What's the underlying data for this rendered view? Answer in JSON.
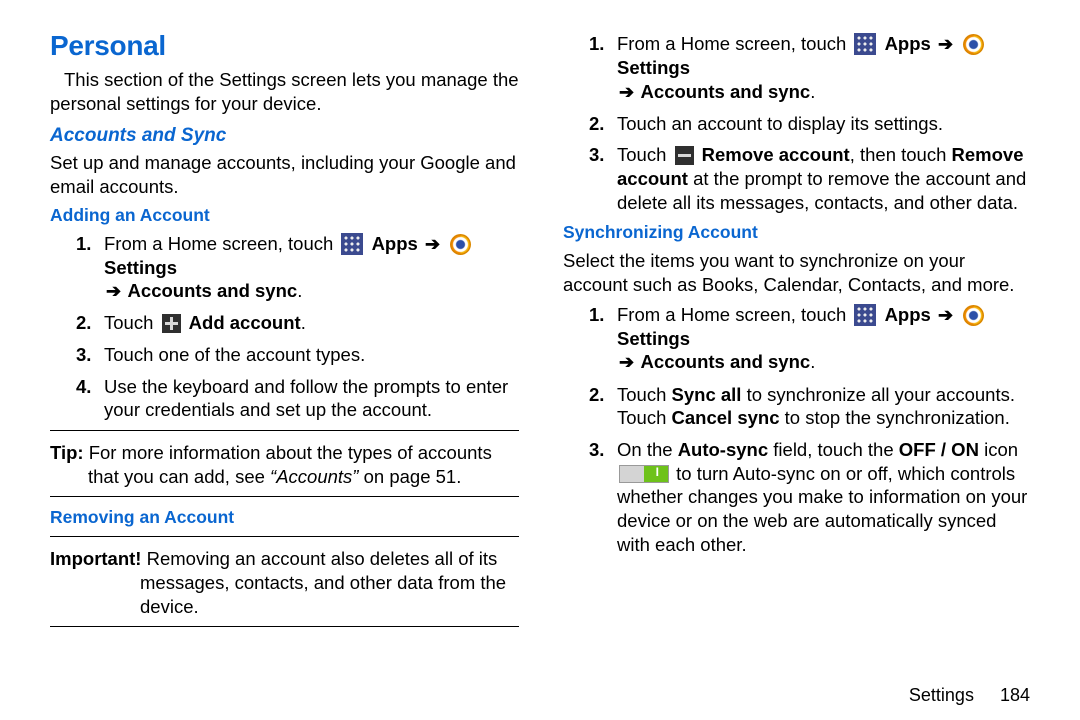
{
  "heading": "Personal",
  "intro": "This section of the Settings screen lets you manage the personal settings for your device.",
  "section1": {
    "title": "Accounts and Sync",
    "desc": "Set up and manage accounts, including your Google and email accounts."
  },
  "adding": {
    "title": "Adding an Account",
    "step1_pre": "From a Home screen, touch ",
    "apps": "Apps",
    "settings": "Settings",
    "accounts_sync": " Accounts and sync",
    "period": ".",
    "step2_pre": "Touch ",
    "add_account": " Add account",
    "step3": "Touch one of the account types.",
    "step4": "Use the keyboard and follow the prompts to enter your credentials and set up the account."
  },
  "tip": {
    "lead": "Tip: ",
    "text_a": "For more information about the types of accounts that you can add, see ",
    "text_ref": "“Accounts”",
    "text_b": " on page 51."
  },
  "removing": {
    "title": "Removing an Account"
  },
  "important": {
    "lead": "Important! ",
    "text": "Removing an account also deletes all of its messages, contacts, and other data from the device."
  },
  "remove_steps": {
    "step1_pre": "From a Home screen, touch ",
    "step2": "Touch an account to display its settings.",
    "step3_pre": "Touch ",
    "remove_account": " Remove account",
    "then": ", then touch ",
    "remove_account2": "Remove account",
    "step3_post": " at the prompt to remove the account and delete all its messages, contacts, and other data."
  },
  "sync": {
    "title": "Synchronizing Account",
    "desc": "Select the items you want to synchronize on your account such as Books, Calendar, Contacts, and more.",
    "step2_a": "Touch ",
    "sync_all": "Sync all",
    "step2_b": " to synchronize all your accounts. Touch ",
    "cancel_sync": "Cancel sync",
    "step2_c": " to stop the synchronization.",
    "step3_a": "On the ",
    "auto_sync": "Auto-sync",
    "step3_b": " field, touch the ",
    "off_on": "OFF / ON",
    "step3_c": " icon ",
    "step3_d": " to turn Auto-sync on or off, which controls whether changes you make to information on your device or on the web are automatically synced with each other."
  },
  "arrow": "➔",
  "footer": {
    "label": "Settings",
    "page": "184"
  }
}
